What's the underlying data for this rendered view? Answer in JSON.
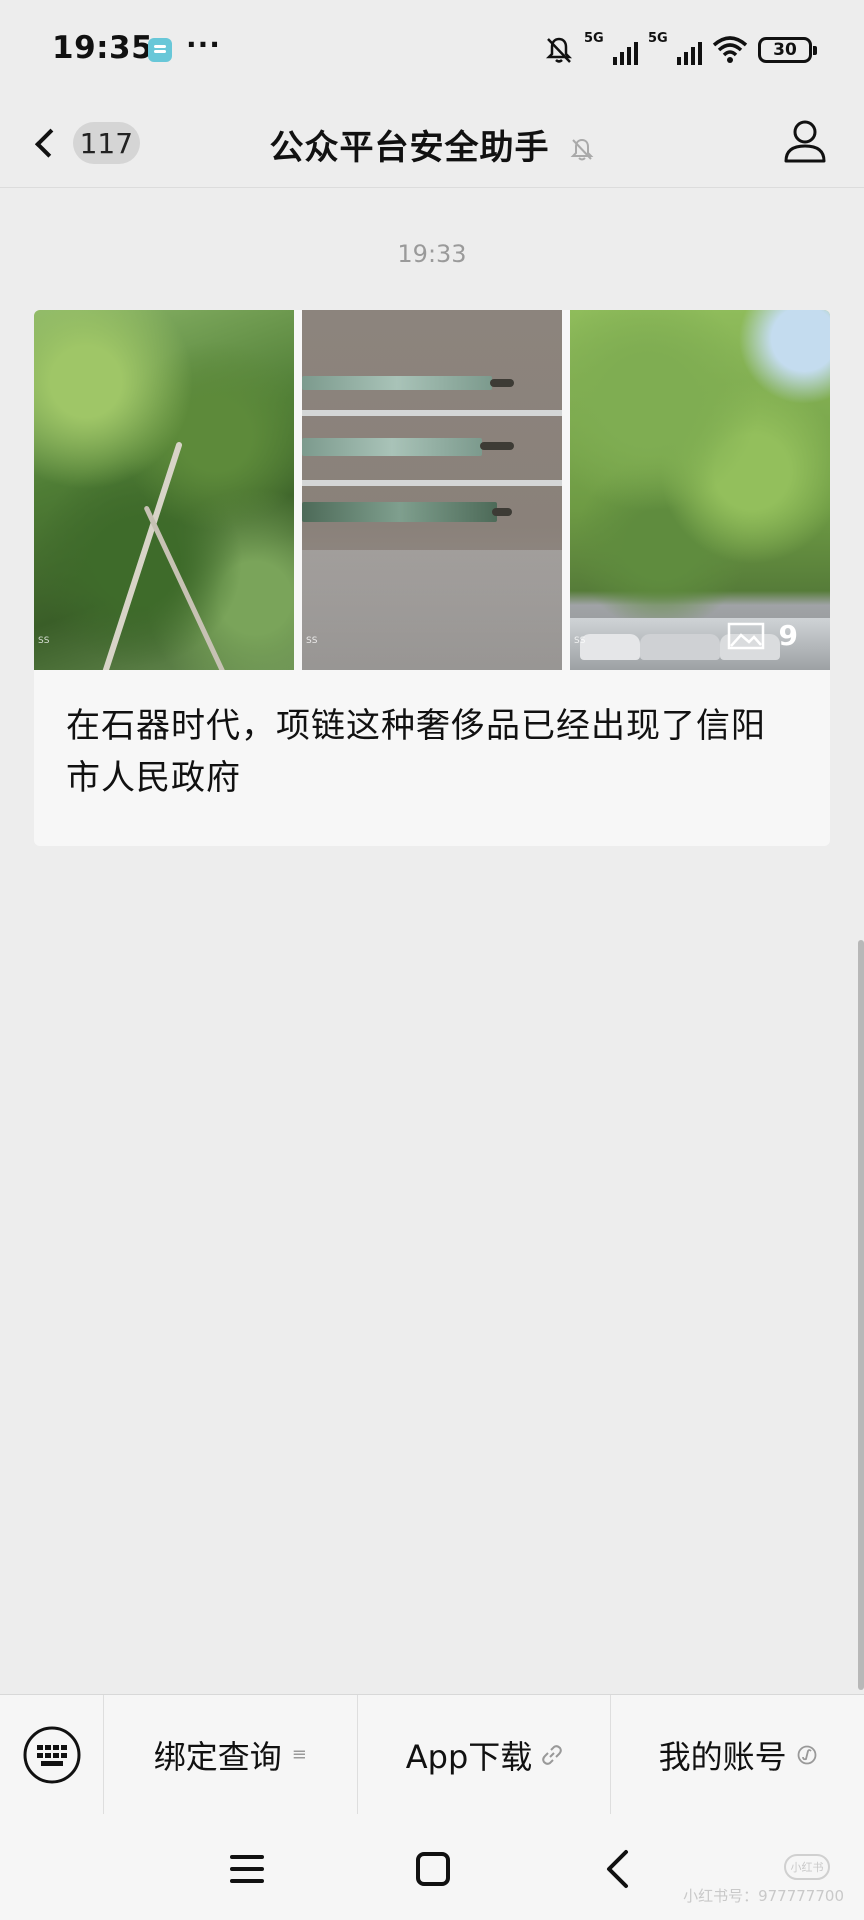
{
  "status_bar": {
    "time": "19:35",
    "overflow_dots": "···",
    "signal1_label": "5G",
    "signal2_label": "5G",
    "battery": "30"
  },
  "header": {
    "unread_count": "117",
    "title": "公众平台安全助手"
  },
  "chat": {
    "timestamp": "19:33",
    "message": {
      "image_count": "9",
      "caption": "在石器时代，项链这种奢侈品已经出现了信阳市人民政府"
    }
  },
  "menu": {
    "items": [
      {
        "label": "绑定查询",
        "icon": "list-icon"
      },
      {
        "label": "App下载",
        "icon": "link-icon"
      },
      {
        "label": "我的账号",
        "icon": "mini-program-icon"
      }
    ]
  },
  "watermark": {
    "logo": "小红书",
    "text": "小红书号：977777700"
  },
  "colors": {
    "background": "#ededed",
    "card": "#f7f7f7",
    "menu_bar": "#f6f6f6"
  }
}
